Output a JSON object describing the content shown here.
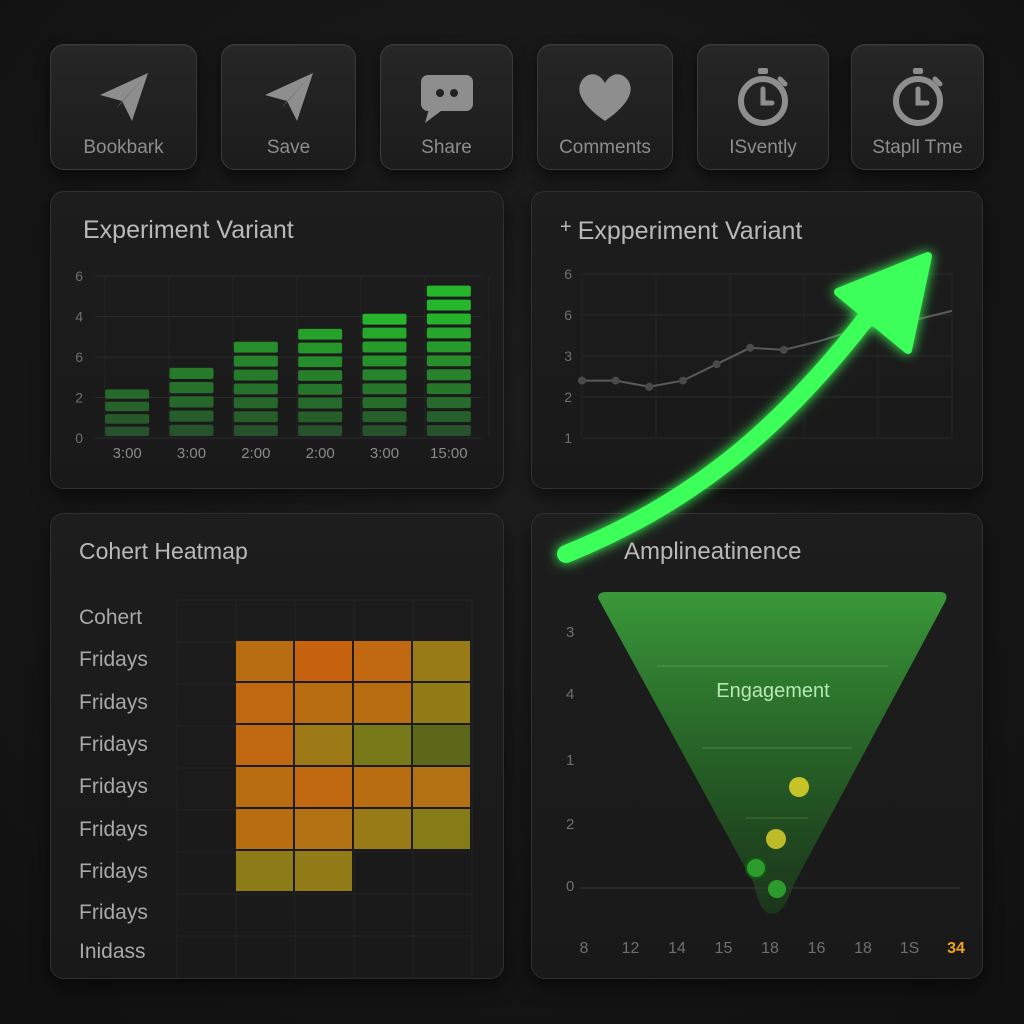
{
  "toolbar": [
    {
      "label": "Bookbark",
      "icon": "paper-plane-icon"
    },
    {
      "label": "Save",
      "icon": "paper-plane-icon"
    },
    {
      "label": "Share",
      "icon": "chat-bubble-icon"
    },
    {
      "label": "Comments",
      "icon": "heart-icon"
    },
    {
      "label": "ISvently",
      "icon": "stopwatch-icon"
    },
    {
      "label": "Stapll Tme",
      "icon": "stopwatch-icon"
    }
  ],
  "bar_panel": {
    "title": "Experiment Variant"
  },
  "line_panel": {
    "title": "Expperiment Variant",
    "prefix": "+"
  },
  "heatmap_panel": {
    "title": "Cohert Heatmap"
  },
  "funnel_panel": {
    "title": "Amplineatinence",
    "funnel_label": "Engagement",
    "highlight_tick": "34"
  },
  "colors": {
    "accent_green": "#3dff5a",
    "heat_orange": "#e58a12",
    "background": "#151515"
  },
  "chart_data": [
    {
      "type": "bar",
      "title": "Experiment Variant",
      "y_ticks": [
        "6",
        "4",
        "6",
        "2",
        "0"
      ],
      "categories": [
        "3:00",
        "3:00",
        "2:00",
        "2:00",
        "3:00",
        "15:00"
      ],
      "values": [
        2.3,
        3.3,
        4.5,
        5.1,
        5.8,
        7.1
      ],
      "ylim": [
        0,
        7.5
      ]
    },
    {
      "type": "line",
      "title": "Expperiment Variant",
      "y_ticks": [
        "6",
        "6",
        "3",
        "2",
        "1"
      ],
      "x": [
        0,
        1,
        2,
        3,
        4,
        5,
        6,
        7,
        8,
        9,
        10,
        11
      ],
      "values": [
        2.8,
        2.8,
        2.5,
        2.8,
        3.6,
        4.4,
        4.3,
        4.7,
        5.2,
        5.6,
        5.8,
        6.2
      ],
      "ylim": [
        0,
        8
      ]
    },
    {
      "type": "heatmap",
      "title": "Cohert Heatmap",
      "row_labels": [
        "Cohert",
        "Fridays",
        "Fridays",
        "Fridays",
        "Fridays",
        "Fridays",
        "Fridays",
        "Fridays",
        "Inidass"
      ],
      "rows": [
        [
          null,
          null,
          null,
          null
        ],
        [
          0.8,
          0.9,
          0.85,
          0.55
        ],
        [
          0.85,
          0.8,
          0.8,
          0.5
        ],
        [
          0.85,
          0.6,
          0.3,
          0.15
        ],
        [
          0.8,
          0.85,
          0.8,
          0.75
        ],
        [
          0.8,
          0.75,
          0.55,
          0.4
        ],
        [
          0.45,
          0.5,
          null,
          null
        ],
        [
          null,
          null,
          null,
          null
        ],
        [
          null,
          null,
          null,
          null
        ]
      ]
    },
    {
      "type": "area",
      "title": "Amplineatinence",
      "y_ticks": [
        "3",
        "4",
        "1",
        "2",
        "0"
      ],
      "x_ticks": [
        "8",
        "12",
        "14",
        "15",
        "18",
        "16",
        "18",
        "1S",
        "34"
      ],
      "annotations": [
        "Engagement"
      ]
    }
  ]
}
